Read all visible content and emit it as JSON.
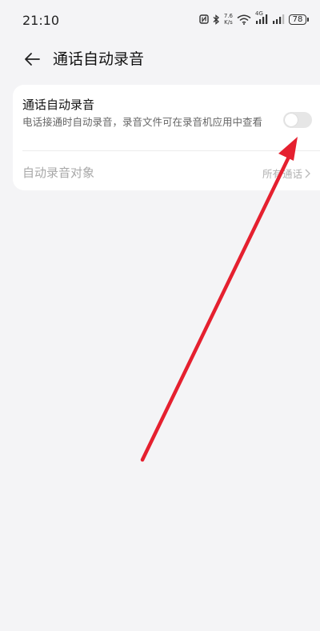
{
  "status_bar": {
    "time": "21:10",
    "net_speed_value": "7.6",
    "net_speed_unit": "K/s",
    "network_type": "4G",
    "battery": "78",
    "icons": [
      "nfc-icon",
      "bluetooth-icon",
      "wifi-icon",
      "signal-icon",
      "battery-icon"
    ]
  },
  "header": {
    "title": "通话自动录音",
    "back_icon": "arrow-left-icon"
  },
  "settings": {
    "auto_record": {
      "title": "通话自动录音",
      "description": "电话接通时自动录音，录音文件可在录音机应用中查看",
      "enabled": false
    },
    "record_target": {
      "label": "自动录音对象",
      "value": "所有通话",
      "chevron_icon": "chevron-right-icon"
    }
  },
  "colors": {
    "background": "#f4f4f6",
    "card": "#ffffff",
    "annotation_arrow": "#e5202f"
  }
}
